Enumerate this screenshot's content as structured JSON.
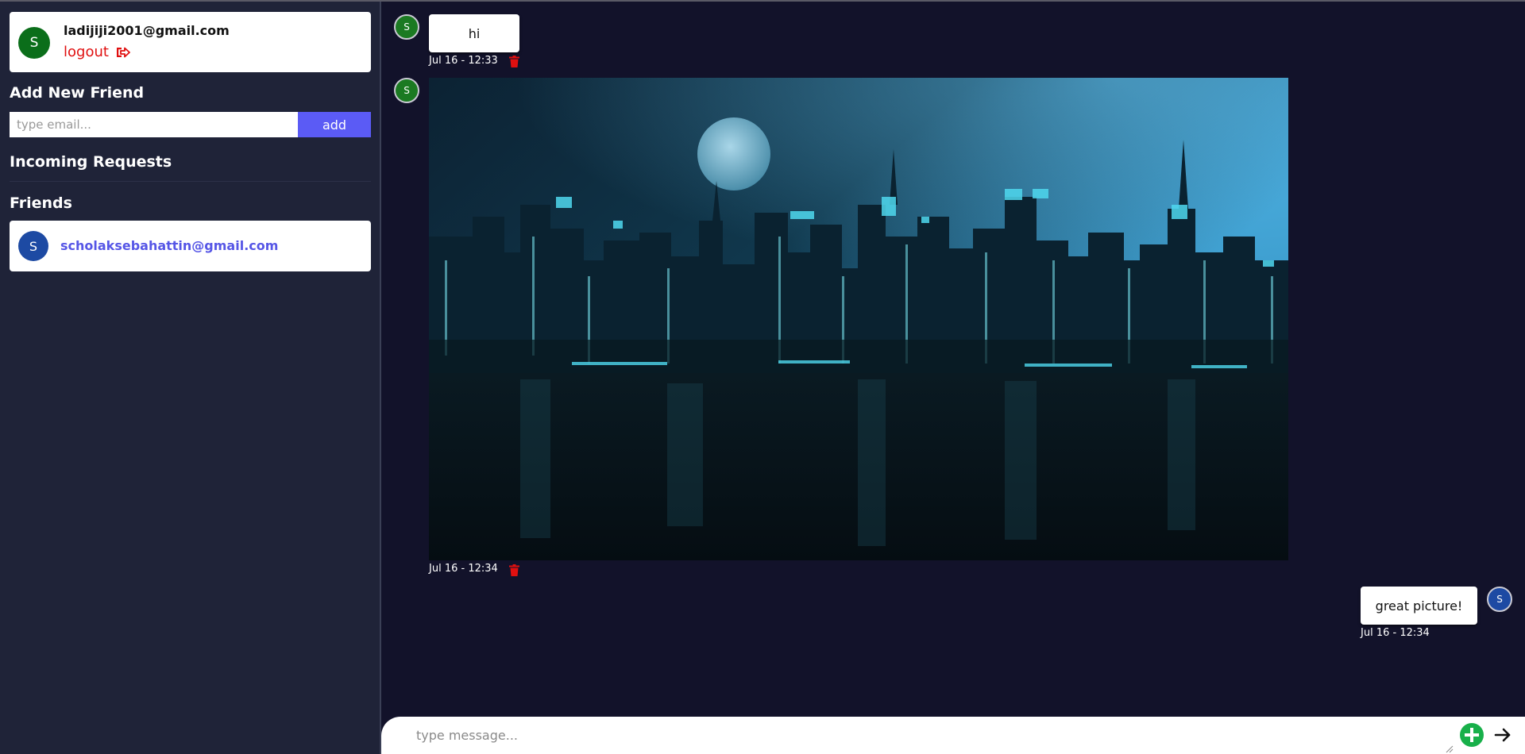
{
  "user": {
    "avatar_letter": "S",
    "email": "ladijiji2001@gmail.com",
    "logout_label": "logout"
  },
  "add_friend": {
    "title": "Add New Friend",
    "input_placeholder": "type email...",
    "button_label": "add"
  },
  "incoming": {
    "title": "Incoming Requests"
  },
  "friends": {
    "title": "Friends",
    "items": [
      {
        "avatar_letter": "S",
        "email": "scholaksebahattin@gmail.com"
      }
    ]
  },
  "messages": [
    {
      "sender": "self",
      "avatar_letter": "S",
      "text": "hi",
      "time": "Jul 16 - 12:33",
      "deletable": true
    },
    {
      "sender": "self",
      "avatar_letter": "S",
      "type": "image",
      "image": "night city skyline with moon reflected in water",
      "time": "Jul 16 - 12:34",
      "deletable": true
    },
    {
      "sender": "friend",
      "avatar_letter": "S",
      "text": "great picture!",
      "time": "Jul 16 - 12:34",
      "deletable": false
    }
  ],
  "composer": {
    "placeholder": "type message..."
  },
  "colors": {
    "sidebar_bg": "#1f2338",
    "chat_bg": "#12122a",
    "accent": "#5b5bf5",
    "danger": "#e01010",
    "self_avatar": "#0b6e1a",
    "friend_avatar": "#1d4aa3",
    "add_attachment": "#18b04a"
  }
}
